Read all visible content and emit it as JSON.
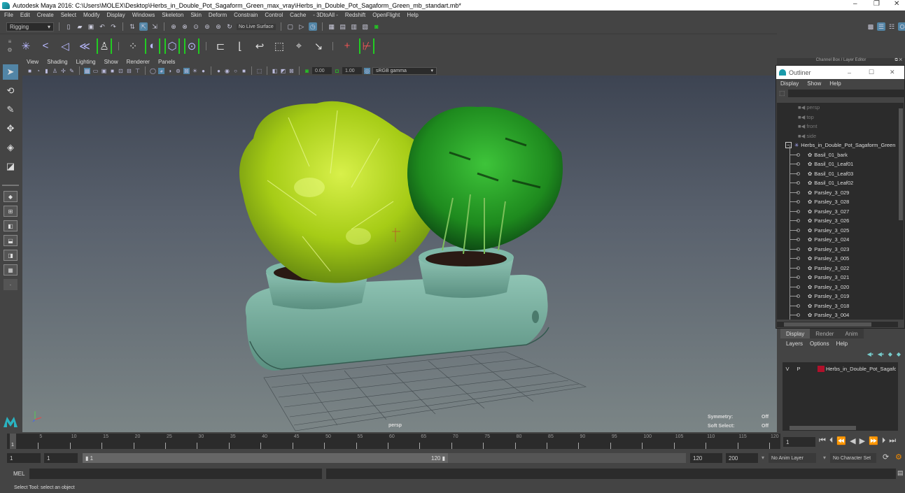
{
  "window": {
    "title": "Autodesk Maya 2016: C:\\Users\\MOLEX\\Desktop\\Herbs_in_Double_Pot_Sagaform_Green_max_vray\\Herbs_in_Double_Pot_Sagaform_Green_mb_standart.mb*",
    "minimize": "–",
    "restore": "❐",
    "close": "✕"
  },
  "menubar": [
    "File",
    "Edit",
    "Create",
    "Select",
    "Modify",
    "Display",
    "Windows",
    "Skeleton",
    "Skin",
    "Deform",
    "Constrain",
    "Control",
    "Cache",
    "- 3DtoAll -",
    "Redshift",
    "OpenFlight",
    "Help"
  ],
  "shelf": {
    "mode": "Rigging",
    "live_surface": "No Live Surface"
  },
  "panel": {
    "menu": [
      "View",
      "Shading",
      "Lighting",
      "Show",
      "Renderer",
      "Panels"
    ],
    "exposure": "0.00",
    "gamma": "1.00",
    "color_space": "sRGB gamma"
  },
  "viewport": {
    "camera": "persp",
    "symmetry_label": "Symmetry:",
    "symmetry_value": "Off",
    "soft_select_label": "Soft Select:",
    "soft_select_value": "Off"
  },
  "right_panel_header": "Channel Box / Layer Editor",
  "outliner": {
    "title": "Outliner",
    "menu": [
      "Display",
      "Show",
      "Help"
    ],
    "cameras": [
      "persp",
      "top",
      "front",
      "side"
    ],
    "group": "Herbs_in_Double_Pot_Sagaform_Green",
    "children": [
      "Basil_01_bark",
      "Basil_01_Leaf01",
      "Basil_01_Leaf03",
      "Basil_01_Leaf02",
      "Parsley_3_029",
      "Parsley_3_028",
      "Parsley_3_027",
      "Parsley_3_026",
      "Parsley_3_025",
      "Parsley_3_024",
      "Parsley_3_023",
      "Parsley_3_005",
      "Parsley_3_022",
      "Parsley_3_021",
      "Parsley_3_020",
      "Parsley_3_019",
      "Parsley_3_018",
      "Parsley_3_004"
    ]
  },
  "layer_editor": {
    "tabs": [
      "Display",
      "Render",
      "Anim"
    ],
    "active_tab": "Display",
    "menu": [
      "Layers",
      "Options",
      "Help"
    ],
    "layers": [
      {
        "v": "V",
        "p": "P",
        "color": "#b0102a",
        "name": "Herbs_in_Double_Pot_Sagaform_Green"
      }
    ]
  },
  "timeline": {
    "ticks": [
      "5",
      "10",
      "15",
      "20",
      "25",
      "30",
      "35",
      "40",
      "45",
      "50",
      "55",
      "60",
      "65",
      "70",
      "75",
      "80",
      "85",
      "90",
      "95",
      "100",
      "105",
      "110",
      "115",
      "120"
    ],
    "current_frame_marker": "1",
    "current_frame": "1"
  },
  "range": {
    "start": "1",
    "playback_start": "1",
    "slider_start": "1",
    "slider_end": "120",
    "playback_end": "120",
    "end": "200",
    "anim_layer": "No Anim Layer",
    "character_set": "No Character Set"
  },
  "command_line": {
    "label": "MEL"
  },
  "status_line": "Select Tool: select an object"
}
